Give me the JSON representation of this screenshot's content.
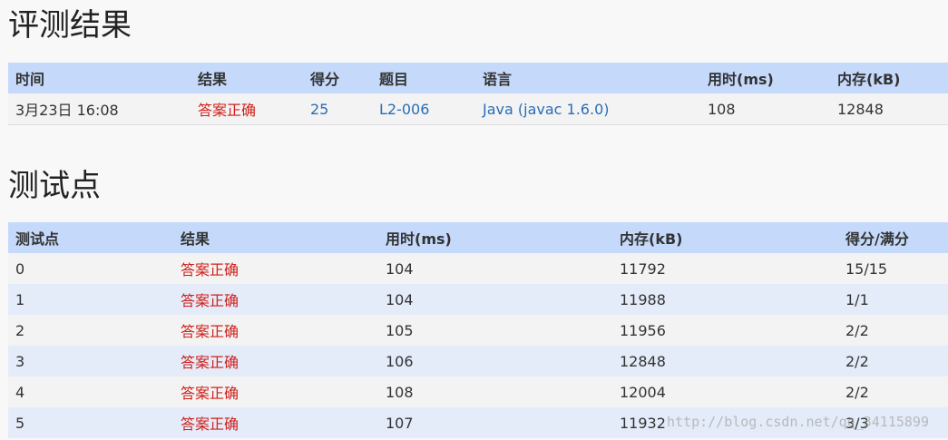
{
  "sections": {
    "result_title": "评测结果",
    "tests_title": "测试点"
  },
  "result_table": {
    "headers": [
      "时间",
      "结果",
      "得分",
      "题目",
      "语言",
      "用时(ms)",
      "内存(kB)"
    ],
    "row": {
      "time": "3月23日 16:08",
      "result": "答案正确",
      "score": "25",
      "problem": "L2-006",
      "language": "Java (javac 1.6.0)",
      "time_ms": "108",
      "memory_kb": "12848"
    }
  },
  "tests_table": {
    "headers": [
      "测试点",
      "结果",
      "用时(ms)",
      "内存(kB)",
      "得分/满分"
    ],
    "rows": [
      {
        "id": "0",
        "result": "答案正确",
        "time_ms": "104",
        "memory_kb": "11792",
        "score": "15/15"
      },
      {
        "id": "1",
        "result": "答案正确",
        "time_ms": "104",
        "memory_kb": "11988",
        "score": "1/1"
      },
      {
        "id": "2",
        "result": "答案正确",
        "time_ms": "105",
        "memory_kb": "11956",
        "score": "2/2"
      },
      {
        "id": "3",
        "result": "答案正确",
        "time_ms": "106",
        "memory_kb": "12848",
        "score": "2/2"
      },
      {
        "id": "4",
        "result": "答案正确",
        "time_ms": "108",
        "memory_kb": "12004",
        "score": "2/2"
      },
      {
        "id": "5",
        "result": "答案正确",
        "time_ms": "107",
        "memory_kb": "11932",
        "score": "3/3"
      }
    ]
  },
  "watermark": "http://blog.csdn.net/qq_34115899",
  "colors": {
    "header_bg": "#c5d9fb",
    "accepted": "#d0201a",
    "link": "#2a6cb8",
    "row_alt": "#e4ebf9"
  }
}
